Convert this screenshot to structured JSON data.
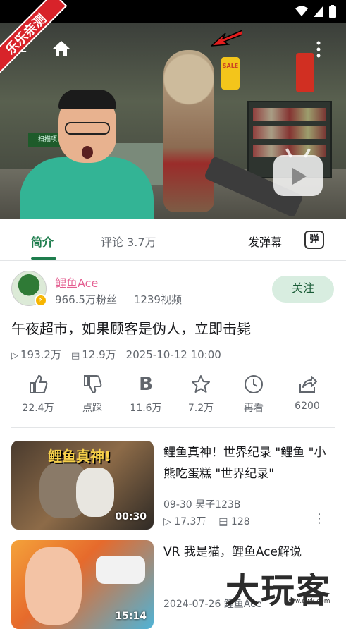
{
  "video": {
    "ribbon_text": "乐乐亲测",
    "sale_sign": "SALE",
    "store_sign": "扫描项目"
  },
  "tabs": [
    {
      "label": "简介"
    },
    {
      "label": "评论 3.7万"
    }
  ],
  "danmu": {
    "send_label": "发弹幕",
    "icon_text": "弹"
  },
  "author": {
    "name": "鲤鱼Ace",
    "fans": "966.5万粉丝",
    "videos": "1239视频",
    "follow_label": "关注"
  },
  "video_info": {
    "title": "午夜超市，如果顾客是伪人，立即击毙",
    "views": "193.2万",
    "danmaku": "12.9万",
    "date": "2025-10-12 10:00"
  },
  "actions": [
    {
      "icon": "thumbs-up-icon",
      "label": "22.4万"
    },
    {
      "icon": "thumbs-down-icon",
      "label": "点踩"
    },
    {
      "icon": "coin-icon",
      "label": "11.6万"
    },
    {
      "icon": "star-icon",
      "label": "7.2万"
    },
    {
      "icon": "clock-icon",
      "label": "再看"
    },
    {
      "icon": "share-icon",
      "label": "6200"
    }
  ],
  "recommendations": [
    {
      "thumb_text": "鲤鱼真神!",
      "duration": "00:30",
      "title": "鲤鱼真神！世界纪录 \"鲤鱼 \"小熊吃蛋糕 \"世界纪录\"",
      "date_author": "09-30  昊子123B",
      "views": "17.3万",
      "danmaku": "128"
    },
    {
      "thumb_text": "",
      "duration": "15:14",
      "title": "VR 我是猫，鲤鱼Ace解说",
      "date_author": "2024-07-26  鲤鱼Ace",
      "views": "",
      "danmaku": ""
    }
  ],
  "watermark": {
    "text": "大玩客",
    "url": "www.dwk.com"
  },
  "colors": {
    "accent": "#1e7d4d",
    "author": "#e45f91",
    "follow_bg": "#d8ede0"
  }
}
